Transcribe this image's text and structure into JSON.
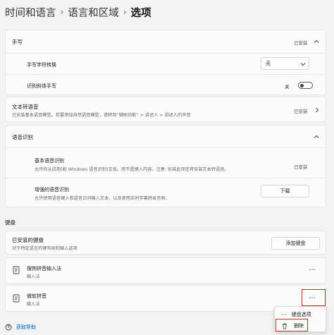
{
  "breadcrumb": {
    "item1": "时间和语言",
    "item2": "语言和区域",
    "current": "选项"
  },
  "handwriting": {
    "title": "手写",
    "status": "已安装",
    "conversion_label": "手写字符转换",
    "conversion_value": "无",
    "italic_label": "识别斜体手写",
    "italic_toggle_label": "关",
    "italic_toggle_on": false
  },
  "tts": {
    "title": "文本转语音",
    "desc": "已安装基本语音模型。若要添加自然语音模型，请转到“辅助功能” > 讲述人 > 讲述人的声音",
    "status": "已安装"
  },
  "speech": {
    "title": "语音识别",
    "basic_title": "基本语音识别",
    "basic_desc": "允许你从应用(如 Windows 语音识别)交谈。而不是键入内容。注意: 安装此项还将安装文本转语音。",
    "basic_status": "已安装",
    "enhanced_title": "增强的语音识别",
    "enhanced_desc": "允许使用语音键入和语音访问输入文本，以及使用实时字幕转录音频。",
    "download_label": "下载"
  },
  "keyboard": {
    "section_title": "键盘",
    "installed_title": "已安装的键盘",
    "installed_desc": "对于特定语言的键布局和输入选项",
    "add_label": "添加键盘",
    "items": [
      {
        "name": "搜狗拼音输入法",
        "type": "输入法"
      },
      {
        "name": "微软拼音",
        "type": "输入法"
      }
    ],
    "more_label": "···"
  },
  "context_menu": {
    "options_label": "键盘选项",
    "remove_label": "删除"
  },
  "footer": {
    "help_label": "获取帮助"
  },
  "colors": {
    "accent": "#0067c0",
    "highlight": "#e02020"
  }
}
